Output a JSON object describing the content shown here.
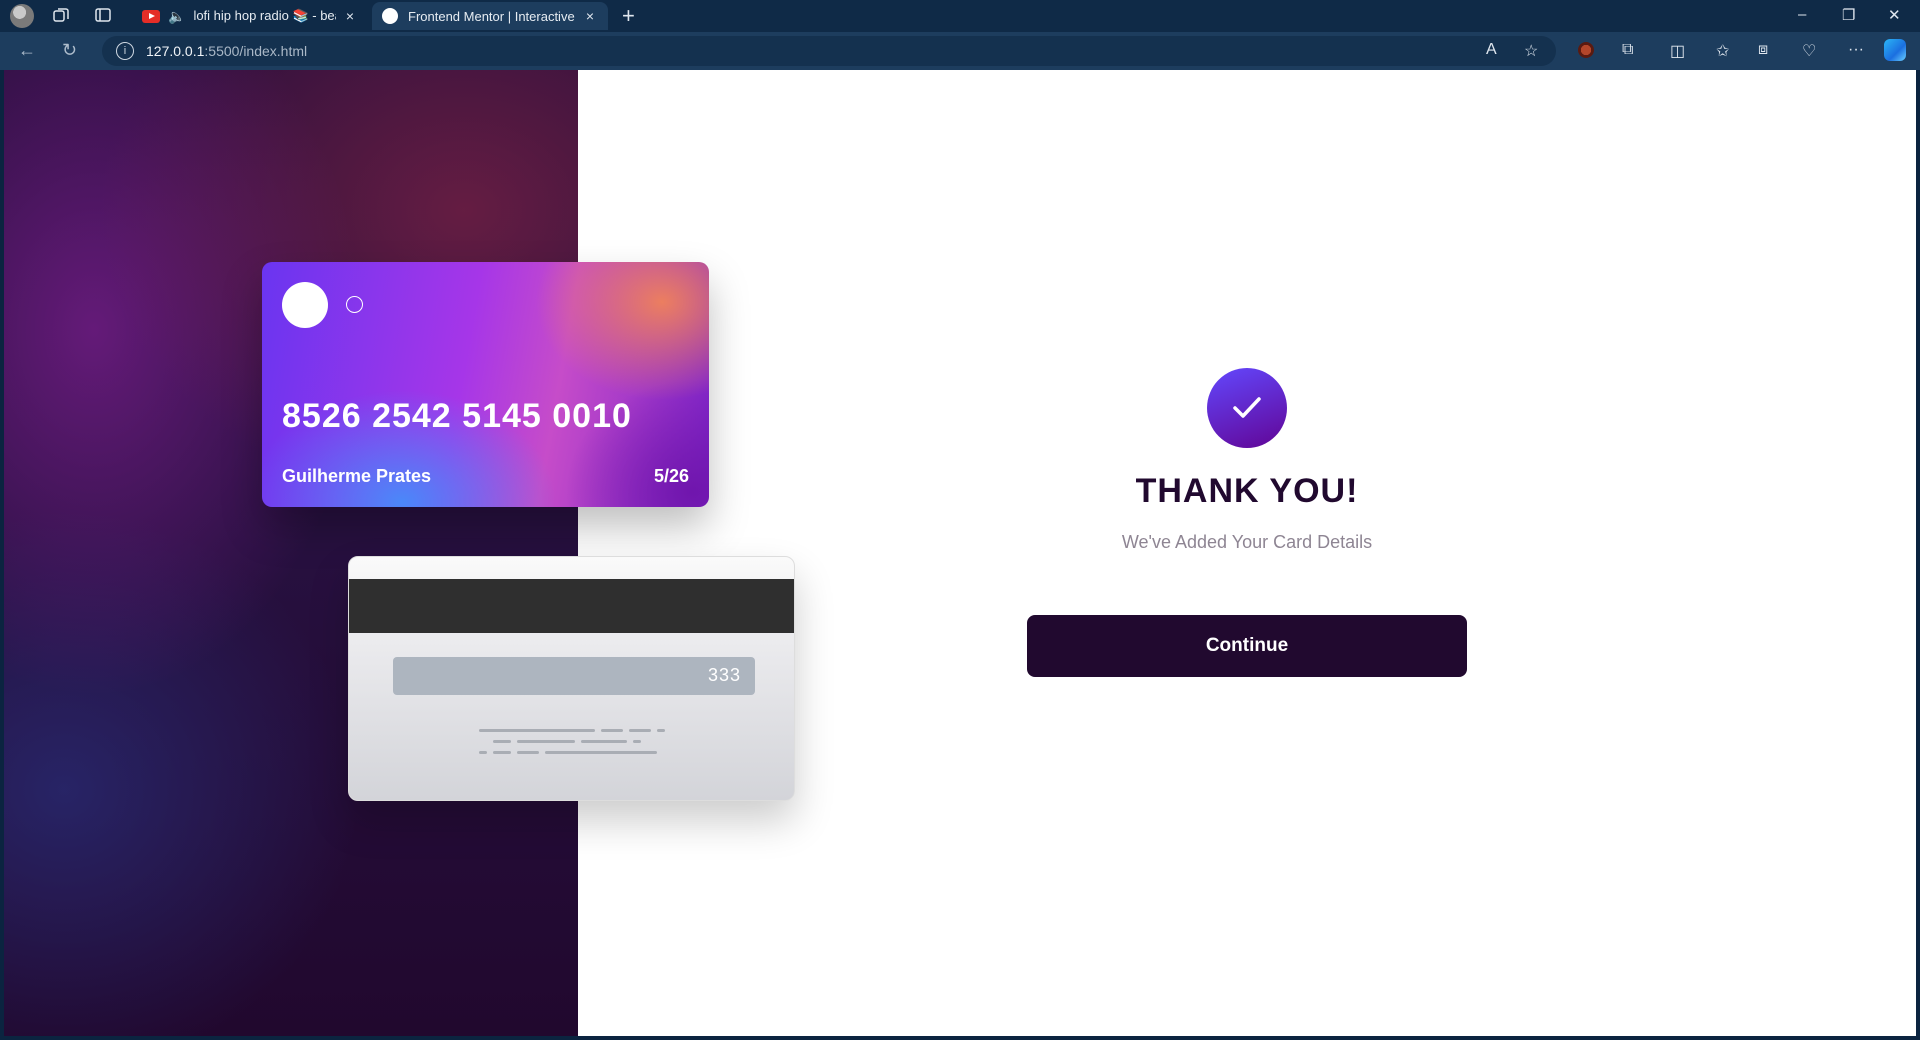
{
  "browser": {
    "tabs": [
      {
        "title": "lofi hip hop radio 📚 - beat",
        "close": "×",
        "audio_icon": "speaker-icon"
      },
      {
        "title": "Frontend Mentor | Interactive ca",
        "close": "×"
      }
    ],
    "new_tab": "+",
    "window_controls": {
      "minimize": "–",
      "restore": "❐",
      "close": "✕"
    },
    "url_host": "127.0.0.1",
    "url_rest": ":5500/index.html",
    "info": "i",
    "read_aloud": "A",
    "more": "···"
  },
  "card_front": {
    "number": "8526 2542 5145 0010",
    "name": "Guilherme Prates",
    "expiry": "5/26"
  },
  "card_back": {
    "cvc": "333"
  },
  "success": {
    "title": "THANK YOU!",
    "subtitle": "We've Added Your Card Details",
    "button": "Continue"
  },
  "colors": {
    "accent_start": "#6348fe",
    "accent_end": "#610595",
    "dark_violet": "#21092f",
    "grey_text": "#8e8593"
  }
}
